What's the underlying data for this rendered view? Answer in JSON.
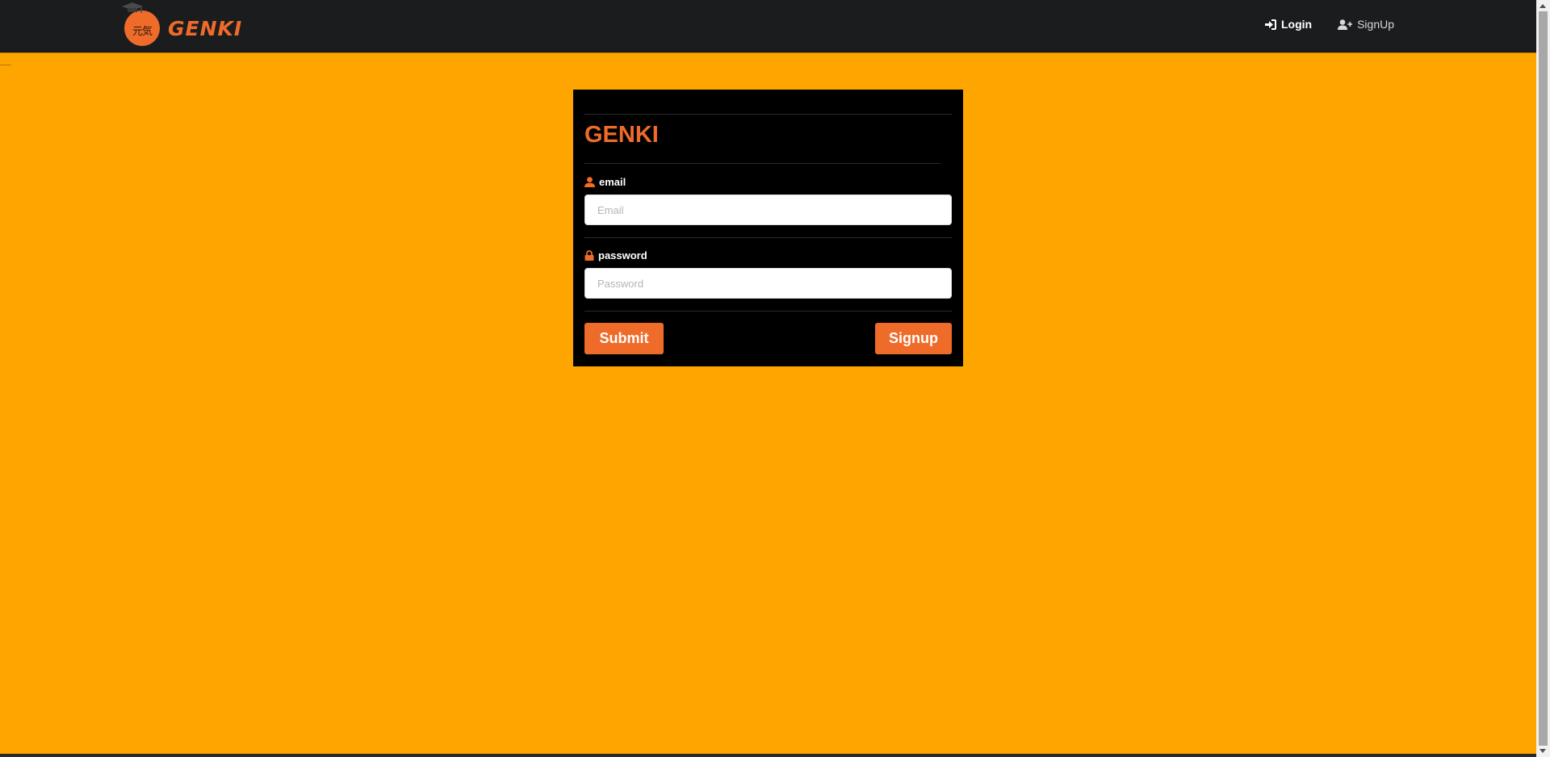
{
  "header": {
    "brand_name": "GENKI",
    "logo_kanji": "元気",
    "nav": [
      {
        "label": "Login",
        "icon": "login-icon"
      },
      {
        "label": "SignUp",
        "icon": "user-plus-icon"
      }
    ]
  },
  "form": {
    "title": "GENKI",
    "email": {
      "label": "email",
      "placeholder": "Email",
      "value": "",
      "icon": "user-icon"
    },
    "password": {
      "label": "password",
      "placeholder": "Password",
      "value": "",
      "icon": "lock-icon"
    },
    "submit_label": "Submit",
    "signup_label": "Signup"
  },
  "colors": {
    "background": "#FFA500",
    "navbar": "#1b1c1e",
    "accent": "#ef6b2a",
    "card": "#000000"
  }
}
